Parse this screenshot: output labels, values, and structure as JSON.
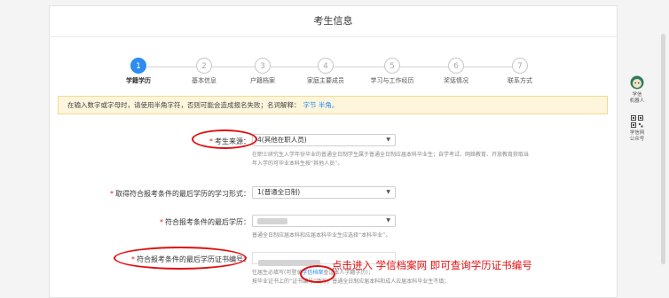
{
  "panel": {
    "title": "考生信息"
  },
  "steps": [
    {
      "num": "1",
      "label": "学籍学历",
      "active": true
    },
    {
      "num": "2",
      "label": "基本信息",
      "active": false
    },
    {
      "num": "3",
      "label": "户籍档案",
      "active": false
    },
    {
      "num": "4",
      "label": "家庭主要成员",
      "active": false
    },
    {
      "num": "5",
      "label": "学习与工作经历",
      "active": false
    },
    {
      "num": "6",
      "label": "奖惩情况",
      "active": false
    },
    {
      "num": "7",
      "label": "联系方式",
      "active": false
    }
  ],
  "notice": {
    "text": "在输入数字或字母时，请使用半角字符，否则可能会造成报名失败；名词解释：",
    "link": "字节 半角。"
  },
  "form": {
    "source": {
      "label": "考生来源：",
      "value": "4(其他在职人员)",
      "help1": "在职士研究生入学年份毕业的普通全日制学生属于普通全日制应届本科毕业生；自学考试、网络教育、开放教育获取当",
      "help2": "年入学的可毕业本科生按“其他人员”。"
    },
    "study_form": {
      "label": "取得符合报考条件的最后学历的学习形式：",
      "value": "1(普通全日制)"
    },
    "degree": {
      "label": "符合报考条件的最后学历：",
      "help": "普通全日制应届本科和应届本科毕业生应选择“本科毕业”。"
    },
    "cert": {
      "label": "符合报考条件的最后学历证书编号：",
      "help_pre": "往届生必填写(可登录",
      "help_link": "学信档案",
      "help_post": "查证本人学籍学历)；",
      "help2": "按毕业证书上的“证书编号”填写；普通全日制应届本科和成人应届本科毕业生不填；"
    }
  },
  "annotation": {
    "text": "点击进入  学信档案网  即可查询学历证书编号"
  },
  "side": {
    "robot_label1": "学信",
    "robot_label2": "机器人",
    "qr_label1": "学信网",
    "qr_label2": "公众号"
  },
  "colors": {
    "accent": "#2d8cf0",
    "annotation": "#e01010",
    "notice_bg": "#fdf5dc"
  }
}
